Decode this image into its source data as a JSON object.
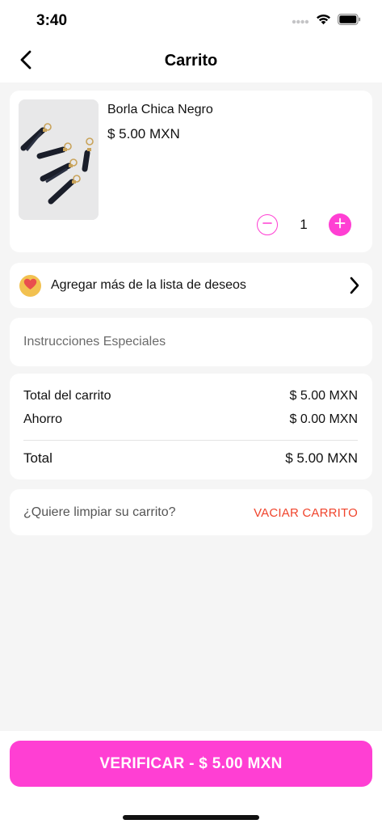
{
  "status_bar": {
    "time": "3:40",
    "icons": [
      "signal-dots-icon",
      "wifi-icon",
      "battery-icon"
    ]
  },
  "header": {
    "title": "Carrito",
    "back_icon": "chevron-left-icon"
  },
  "cart_item": {
    "name": "Borla Chica Negro",
    "price": "$ 5.00 MXN",
    "quantity": "1",
    "image": "black-tassels-photo"
  },
  "wishlist": {
    "label": "Agregar más de la lista de deseos",
    "icon": "heart-icon"
  },
  "instructions": {
    "placeholder": "Instrucciones Especiales",
    "value": ""
  },
  "totals": {
    "subtotal_label": "Total del carrito",
    "subtotal_value": "$ 5.00 MXN",
    "savings_label": "Ahorro",
    "savings_value": "$ 0.00 MXN",
    "total_label": "Total",
    "total_value": "$ 5.00 MXN"
  },
  "clear_cart": {
    "question": "¿Quiere limpiar su carrito?",
    "action_label": "VACIAR CARRITO"
  },
  "checkout": {
    "label": "VERIFICAR - $ 5.00 MXN"
  },
  "colors": {
    "accent": "#ff3fd3",
    "danger": "#f0442c",
    "heart_badge": "#f2c150",
    "heart": "#e94e4e",
    "background": "#f5f5f5"
  }
}
